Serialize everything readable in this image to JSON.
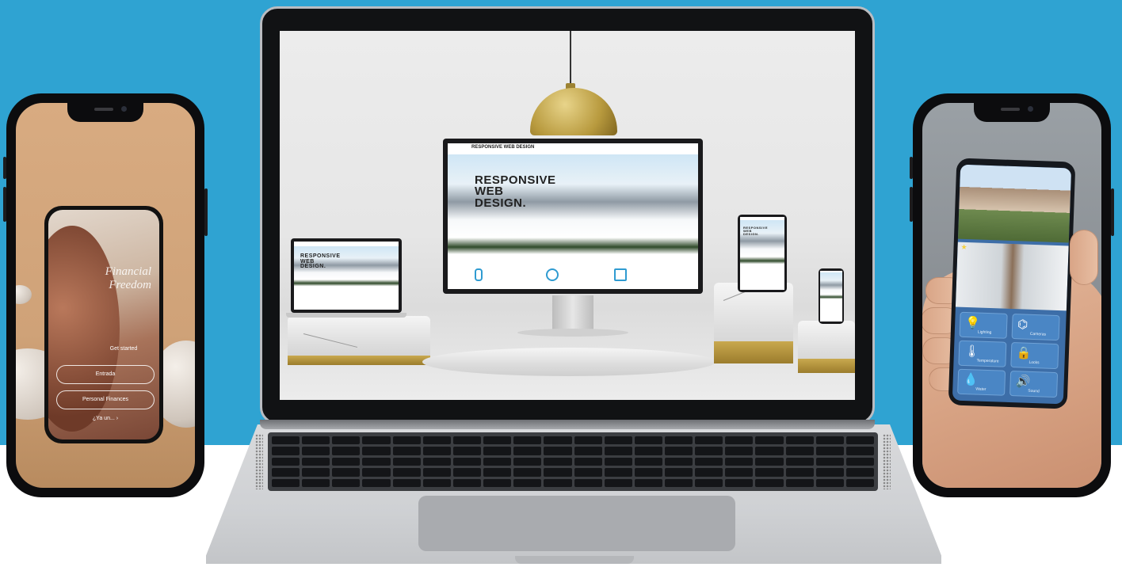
{
  "colors": {
    "background_blue": "#2fa3d2",
    "background_white": "#ffffff",
    "accent_blue": "#2f9bd1"
  },
  "left_phone": {
    "app_title": "Financial Freedom",
    "subtitle_lines": "",
    "buttons": [
      "Get started",
      "Entrada",
      "Personal Finances"
    ],
    "link": "¿Ya un... ›"
  },
  "laptop_site": {
    "nav_brand": "RESPONSIVE WEB DESIGN",
    "hero_title_line1": "RESPONSIVE",
    "hero_title_line2": "WEB",
    "hero_title_line3": "DESIGN.",
    "features": [
      {
        "icon": "tablet-icon",
        "text": ""
      },
      {
        "icon": "gear-icon",
        "text": ""
      },
      {
        "icon": "home-icon",
        "text": ""
      }
    ]
  },
  "right_phone": {
    "tiles": [
      {
        "icon": "lightbulb-icon",
        "label": "Lighting",
        "glyph": "💡"
      },
      {
        "icon": "camera-icon",
        "label": "Cameras",
        "glyph": "⌬"
      },
      {
        "icon": "thermometer-icon",
        "label": "Temperature",
        "glyph": "🌡"
      },
      {
        "icon": "lock-icon",
        "label": "Locks",
        "glyph": "🔒"
      },
      {
        "icon": "water-drop-icon",
        "label": "Water",
        "glyph": "💧"
      },
      {
        "icon": "sound-icon",
        "label": "Sound",
        "glyph": "🔊"
      }
    ]
  }
}
